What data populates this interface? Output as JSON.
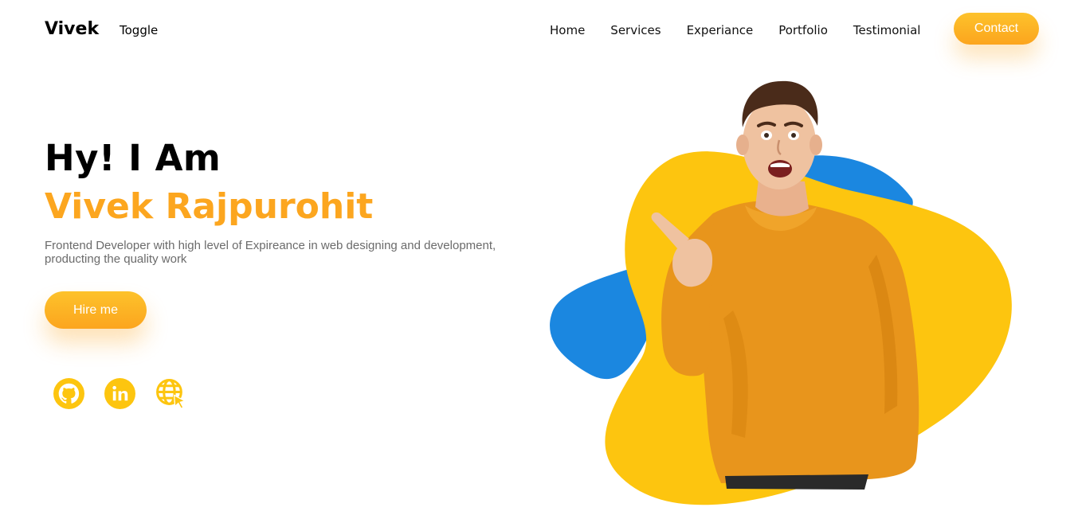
{
  "nav": {
    "logo": "Vivek",
    "toggle": "Toggle",
    "links": [
      "Home",
      "Services",
      "Experiance",
      "Portfolio",
      "Testimonial"
    ],
    "contact_label": "Contact"
  },
  "hero": {
    "greeting": "Hy! I Am",
    "name": "Vivek Rajpurohit",
    "description": "Frontend Developer with high level of Expireance in web designing and development, producting the quality work",
    "hire_label": "Hire me"
  },
  "socials": {
    "icons": [
      "github-icon",
      "linkedin-icon",
      "website-icon"
    ]
  },
  "colors": {
    "accent_orange": "#fca61f",
    "accent_yellow": "#fdc50f",
    "blob_blue": "#1b87e0",
    "sweater": "#e8951c"
  }
}
